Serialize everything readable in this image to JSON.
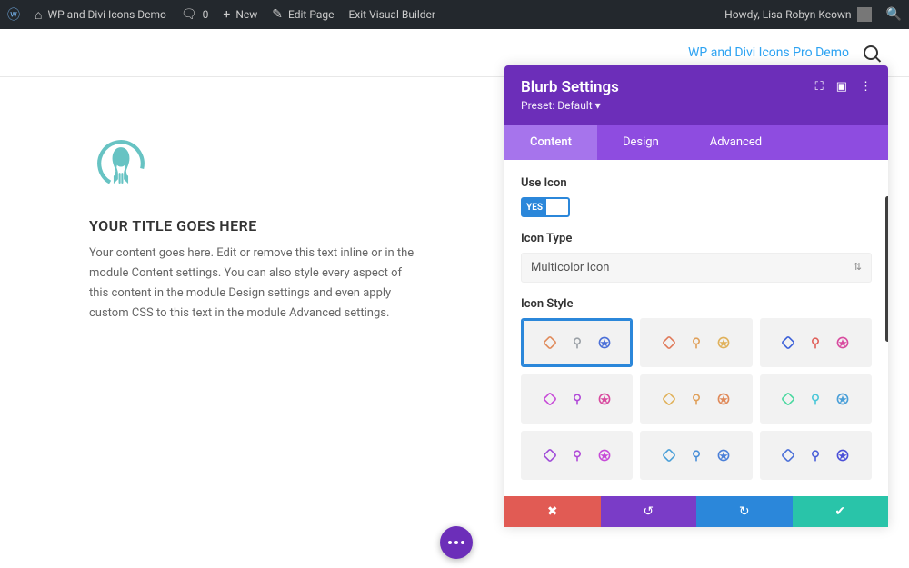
{
  "wpbar": {
    "site": "WP and Divi Icons Demo",
    "comments": "0",
    "new": "New",
    "edit": "Edit Page",
    "exit": "Exit Visual Builder",
    "howdy": "Howdy, Lisa-Robyn Keown"
  },
  "secondary": {
    "link": "WP and Divi Icons Pro Demo"
  },
  "blurb": {
    "title": "YOUR TITLE GOES HERE",
    "text": "Your content goes here. Edit or remove this text inline or in the module Content settings. You can also style every aspect of this content in the module Design settings and even apply custom CSS to this text in the module Advanced settings."
  },
  "panel": {
    "title": "Blurb Settings",
    "preset": "Preset: Default",
    "tabs": [
      "Content",
      "Design",
      "Advanced"
    ],
    "activeTab": 0,
    "useIconLabel": "Use Icon",
    "useIconValue": "YES",
    "iconTypeLabel": "Icon Type",
    "iconTypeValue": "Multicolor Icon",
    "iconStyleLabel": "Icon Style",
    "styles": [
      {
        "id": "style-1",
        "selected": true,
        "scheme": [
          "#e08a5a",
          "#9aa0a6",
          "#4a6fd8"
        ]
      },
      {
        "id": "style-2",
        "selected": false,
        "scheme": [
          "#e07a5a",
          "#e0a05a",
          "#e0b15a"
        ]
      },
      {
        "id": "style-3",
        "selected": false,
        "scheme": [
          "#3a5fd8",
          "#e0605a",
          "#d84a9f"
        ]
      },
      {
        "id": "style-4",
        "selected": false,
        "scheme": [
          "#c74ad8",
          "#b14ad8",
          "#d84a9f"
        ]
      },
      {
        "id": "style-5",
        "selected": false,
        "scheme": [
          "#e0b15a",
          "#e0a05a",
          "#e08a5a"
        ]
      },
      {
        "id": "style-6",
        "selected": false,
        "scheme": [
          "#4ad8a0",
          "#4ac7d8",
          "#4a9fd8"
        ]
      },
      {
        "id": "style-7",
        "selected": false,
        "scheme": [
          "#9f4ad8",
          "#b14ad8",
          "#c74ad8"
        ]
      },
      {
        "id": "style-8",
        "selected": false,
        "scheme": [
          "#4a9fd8",
          "#4a8fd8",
          "#4a7fd8"
        ]
      },
      {
        "id": "style-9",
        "selected": false,
        "scheme": [
          "#4a6fd8",
          "#4a5fd8",
          "#4a4fd8"
        ]
      }
    ]
  }
}
